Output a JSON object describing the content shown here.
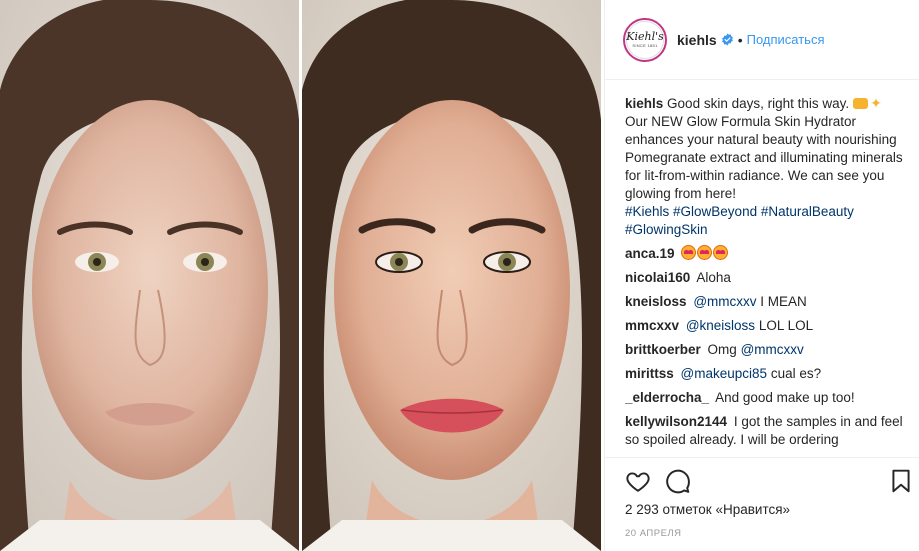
{
  "post": {
    "images": [
      {
        "description": "model portrait without makeup"
      },
      {
        "description": "model portrait with makeup"
      }
    ]
  },
  "header": {
    "avatar_logo": "Kiehl's",
    "avatar_sub": "SINCE 1851",
    "username": "kiehls",
    "dot": "•",
    "follow_label": "Подписаться"
  },
  "caption": {
    "username": "kiehls",
    "text": "Good skin days, right this way.",
    "body": "Our NEW Glow Formula Skin Hydrator enhances your natural beauty with nourishing Pomegranate extract and illuminating minerals for lit-from-within radiance. We can see you glowing from here!",
    "hashtags": "#Kiehls #GlowBeyond #NaturalBeauty #GlowingSkin"
  },
  "comments": [
    {
      "user": "anca.19",
      "mention": "",
      "text": ""
    },
    {
      "user": "nicolai160",
      "mention": "",
      "text": "Aloha"
    },
    {
      "user": "kneisloss",
      "mention": "@mmcxxv",
      "text": "I MEAN"
    },
    {
      "user": "mmcxxv",
      "mention": "@kneisloss",
      "text": "LOL LOL"
    },
    {
      "user": "brittkoerber",
      "mention": "",
      "text": "Omg ",
      "trailing_mention": "@mmcxxv"
    },
    {
      "user": "mirittss",
      "mention": "@makeupci85",
      "text": "cual es?"
    },
    {
      "user": "_elderrocha_",
      "mention": "",
      "text": "And good make up too!"
    },
    {
      "user": "kellywilson2144",
      "mention": "",
      "text": "I got the samples in and feel so spoiled already. I will be ordering"
    }
  ],
  "actions": {
    "likes": "2 293 отметок «Нравится»",
    "date": "20 АПРЕЛЯ"
  },
  "colors": {
    "link": "#3897f0",
    "hashtag": "#003569",
    "text": "#262626",
    "muted": "#999999"
  }
}
